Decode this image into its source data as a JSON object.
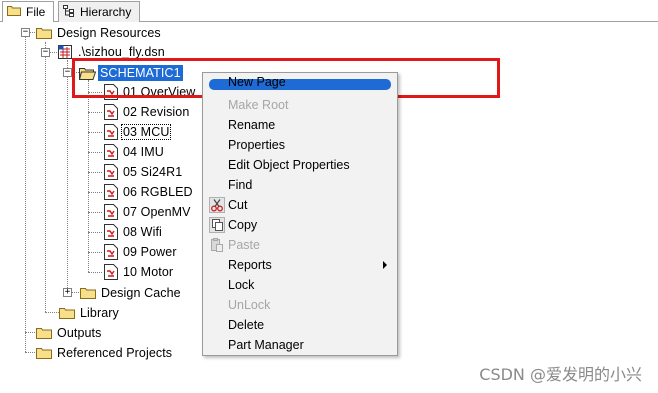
{
  "tabs": [
    {
      "label": "File"
    },
    {
      "label": "Hierarchy"
    }
  ],
  "tree": {
    "root": "Design Resources",
    "design_file": ".\\sizhou_fly.dsn",
    "schematic": "SCHEMATIC1",
    "pages": [
      "01 OverView",
      "02 Revision",
      "03 MCU",
      "04 IMU",
      "05 Si24R1",
      "06 RGBLED",
      "07 OpenMV",
      "08 Wifi",
      "09 Power",
      "10 Motor"
    ],
    "design_cache": "Design Cache",
    "library": "Library",
    "outputs": "Outputs",
    "referenced_projects": "Referenced Projects"
  },
  "context_menu": {
    "items": [
      {
        "label": "New Page",
        "enabled": true,
        "highlighted": true
      },
      {
        "label": "Make Root",
        "enabled": false
      },
      {
        "label": "Rename",
        "enabled": true
      },
      {
        "label": "Properties",
        "enabled": true
      },
      {
        "label": "Edit Object Properties",
        "enabled": true
      },
      {
        "label": "Find",
        "enabled": true
      },
      {
        "label": "Cut",
        "enabled": true,
        "icon": "scissors-icon"
      },
      {
        "label": "Copy",
        "enabled": true,
        "icon": "copy-icon"
      },
      {
        "label": "Paste",
        "enabled": false,
        "icon": "paste-icon"
      },
      {
        "label": "Reports",
        "enabled": true,
        "submenu": true
      },
      {
        "label": "Lock",
        "enabled": true
      },
      {
        "label": "UnLock",
        "enabled": false
      },
      {
        "label": "Delete",
        "enabled": true
      },
      {
        "label": "Part Manager",
        "enabled": true
      }
    ]
  },
  "watermark": "CSDN @爱发明的小兴",
  "colors": {
    "selection": "#1e6bd6",
    "highlight_box": "#e01818",
    "menu_bg": "#f2f2f2",
    "folder": "#f8e08a"
  }
}
